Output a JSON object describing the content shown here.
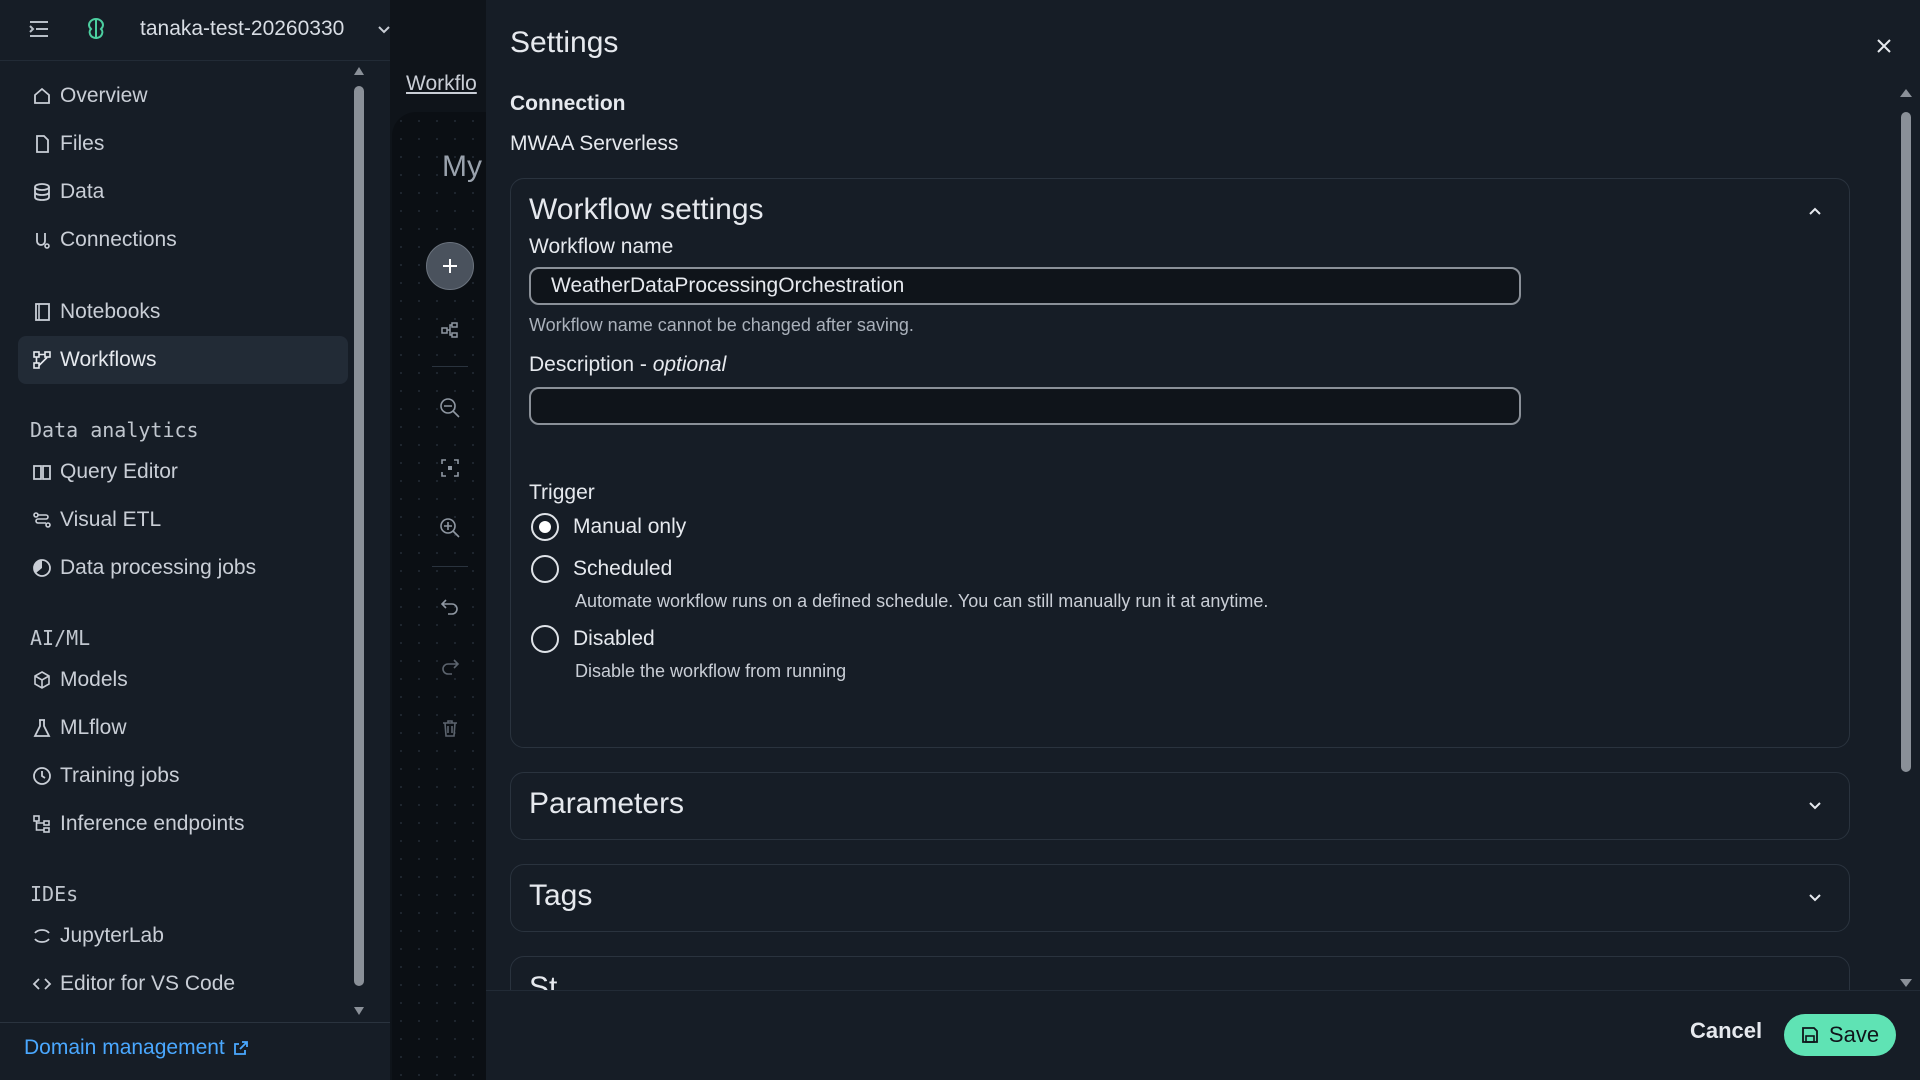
{
  "topbar": {
    "project_name": "tanaka-test-20260330"
  },
  "sidebar": {
    "items_main": [
      {
        "label": "Overview",
        "icon": "home-icon"
      },
      {
        "label": "Files",
        "icon": "file-icon"
      },
      {
        "label": "Data",
        "icon": "database-icon"
      },
      {
        "label": "Connections",
        "icon": "connections-icon"
      }
    ],
    "items_dev": [
      {
        "label": "Notebooks",
        "icon": "notebook-icon"
      },
      {
        "label": "Workflows",
        "icon": "workflow-icon",
        "active": true
      }
    ],
    "section_data_analytics": "Data analytics",
    "items_analytics": [
      {
        "label": "Query Editor",
        "icon": "book-icon"
      },
      {
        "label": "Visual ETL",
        "icon": "etl-icon"
      },
      {
        "label": "Data processing jobs",
        "icon": "processing-icon"
      }
    ],
    "section_aiml": "AI/ML",
    "items_aiml": [
      {
        "label": "Models",
        "icon": "cube-icon"
      },
      {
        "label": "MLflow",
        "icon": "flask-icon"
      },
      {
        "label": "Training jobs",
        "icon": "clock-icon"
      },
      {
        "label": "Inference endpoints",
        "icon": "endpoints-icon"
      }
    ],
    "section_ides": "IDEs",
    "items_ides": [
      {
        "label": "JupyterLab",
        "icon": "jupyter-icon"
      },
      {
        "label": "Editor for VS Code",
        "icon": "code-icon"
      }
    ],
    "domain_management": "Domain management"
  },
  "background": {
    "breadcrumb_peek": "Workflo",
    "canvas_title_peek": "My"
  },
  "panel": {
    "title": "Settings",
    "connection_label": "Connection",
    "connection_value": "MWAA Serverless",
    "workflow_settings": {
      "title": "Workflow settings",
      "name_label": "Workflow name",
      "name_value": "WeatherDataProcessingOrchestration",
      "name_hint": "Workflow name cannot be changed after saving.",
      "description_label": "Description - ",
      "description_optional": "optional",
      "description_value": "",
      "trigger_label": "Trigger",
      "trigger_options": [
        {
          "label": "Manual only",
          "description": "",
          "checked": true
        },
        {
          "label": "Scheduled",
          "description": "Automate workflow runs on a defined schedule. You can still manually run it at anytime.",
          "checked": false
        },
        {
          "label": "Disabled",
          "description": "Disable the workflow from running",
          "checked": false
        }
      ]
    },
    "parameters_title": "Parameters",
    "tags_title": "Tags",
    "partial_section_title": "St",
    "cancel_label": "Cancel",
    "save_label": "Save"
  },
  "colors": {
    "accent": "#5fe3b4",
    "link": "#4aa8ff",
    "background": "#0f141a",
    "panel": "#161d26"
  }
}
